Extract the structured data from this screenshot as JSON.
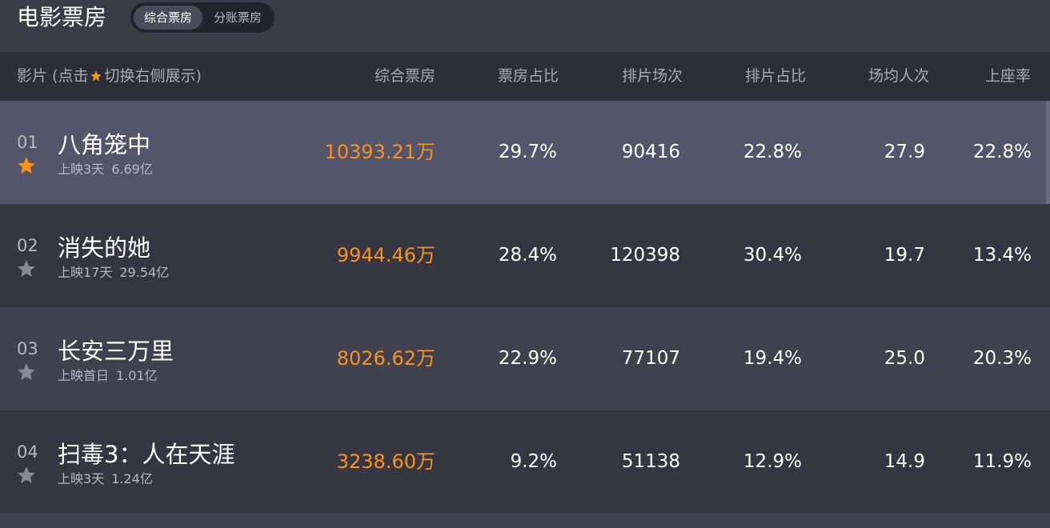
{
  "header": {
    "title": "电影票房",
    "tabs": [
      {
        "label": "综合票房",
        "active": true
      },
      {
        "label": "分账票房",
        "active": false
      }
    ]
  },
  "columns": {
    "film_prefix": "影片 (点击",
    "film_suffix": "切换右侧展示)",
    "gross": "综合票房",
    "gross_share": "票房占比",
    "shows": "排片场次",
    "show_share": "排片占比",
    "avg_viewers": "场均人次",
    "occupancy": "上座率"
  },
  "colors": {
    "accent": "#f6931e",
    "star_inactive": "#8a8a96",
    "selected_row": "#54546a"
  },
  "rows": [
    {
      "rank": "01",
      "title": "八角笼中",
      "release": "上映3天",
      "total": "6.69亿",
      "gross": "10393.21万",
      "gross_share": "29.7%",
      "shows": "90416",
      "show_share": "22.8%",
      "avg_viewers": "27.9",
      "occupancy": "22.8%",
      "starred": true,
      "icon": "star-filled-icon"
    },
    {
      "rank": "02",
      "title": "消失的她",
      "release": "上映17天",
      "total": "29.54亿",
      "gross": "9944.46万",
      "gross_share": "28.4%",
      "shows": "120398",
      "show_share": "30.4%",
      "avg_viewers": "19.7",
      "occupancy": "13.4%",
      "starred": false,
      "icon": "star-outline-icon"
    },
    {
      "rank": "03",
      "title": "长安三万里",
      "release": "上映首日",
      "total": "1.01亿",
      "gross": "8026.62万",
      "gross_share": "22.9%",
      "shows": "77107",
      "show_share": "19.4%",
      "avg_viewers": "25.0",
      "occupancy": "20.3%",
      "starred": false,
      "icon": "star-outline-icon"
    },
    {
      "rank": "04",
      "title": "扫毒3：人在天涯",
      "release": "上映3天",
      "total": "1.24亿",
      "gross": "3238.60万",
      "gross_share": "9.2%",
      "shows": "51138",
      "show_share": "12.9%",
      "avg_viewers": "14.9",
      "occupancy": "11.9%",
      "starred": false,
      "icon": "star-outline-icon"
    }
  ]
}
